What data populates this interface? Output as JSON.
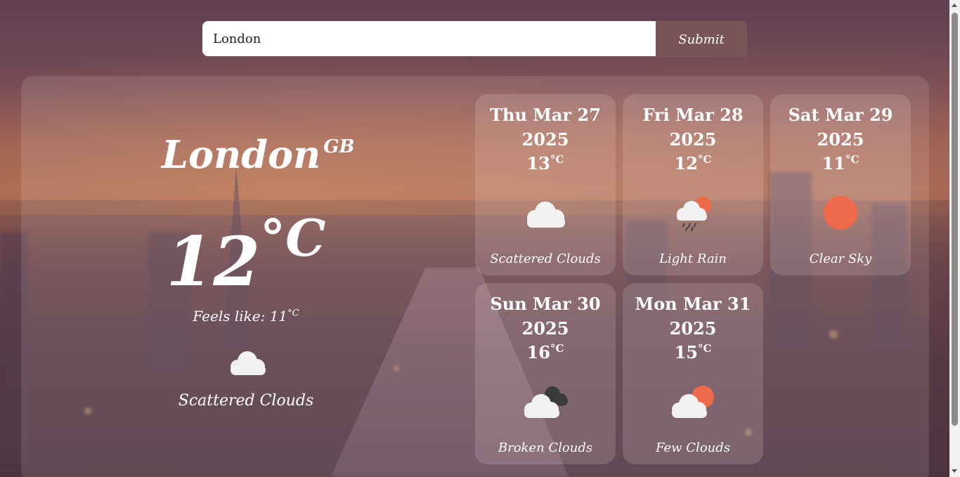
{
  "search": {
    "value": "London",
    "placeholder": "",
    "submit_label": "Submit"
  },
  "current": {
    "city": "London",
    "country": "GB",
    "temp": "12",
    "temp_unit": "°C",
    "feels_label": "Feels like: 11",
    "feels_unit": "°C",
    "icon": "cloud-icon",
    "description": "Scattered Clouds"
  },
  "forecast": [
    {
      "day": "Thu Mar 27",
      "year": "2025",
      "temp": "13",
      "unit": "°C",
      "icon": "cloud-icon",
      "description": "Scattered Clouds"
    },
    {
      "day": "Fri Mar 28",
      "year": "2025",
      "temp": "12",
      "unit": "°C",
      "icon": "rain-cloud-sun-icon",
      "description": "Light Rain"
    },
    {
      "day": "Sat Mar 29",
      "year": "2025",
      "temp": "11",
      "unit": "°C",
      "icon": "sun-icon",
      "description": "Clear Sky"
    },
    {
      "day": "Sun Mar 30",
      "year": "2025",
      "temp": "16",
      "unit": "°C",
      "icon": "broken-clouds-icon",
      "description": "Broken Clouds"
    },
    {
      "day": "Mon Mar 31",
      "year": "2025",
      "temp": "15",
      "unit": "°C",
      "icon": "few-clouds-icon",
      "description": "Few Clouds"
    }
  ],
  "colors": {
    "submit_bg": "#7a5558",
    "sun": "#ee6a4a",
    "cloud": "#f1f1f1",
    "dark_cloud": "#3a3a3a"
  }
}
